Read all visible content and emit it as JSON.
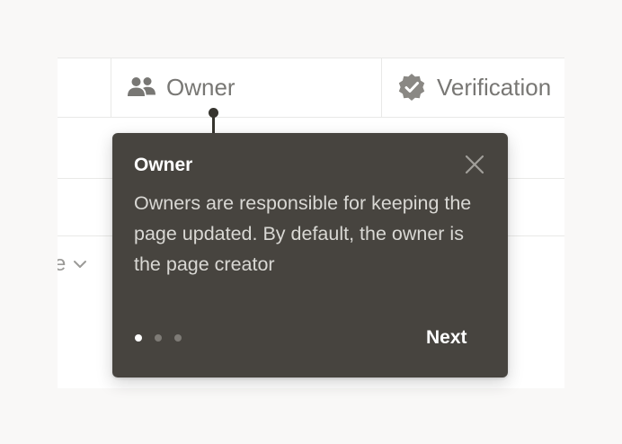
{
  "table": {
    "columns": [
      {
        "label": "Owner",
        "icon": "people-icon"
      },
      {
        "label": "Verification",
        "icon": "verified-badge-icon"
      }
    ],
    "partial_cell": {
      "text": "e",
      "icon": "chevron-down-icon"
    }
  },
  "tooltip": {
    "title": "Owner",
    "body": "Owners are responsible for keeping the page updated. By default, the owner is the page creator",
    "close_icon": "close-icon",
    "steps": {
      "current": 1,
      "total": 3
    },
    "next_label": "Next"
  },
  "colors": {
    "tooltip_bg": "#47443f",
    "header_text": "#787774",
    "grid_line": "#e9e9e7"
  }
}
